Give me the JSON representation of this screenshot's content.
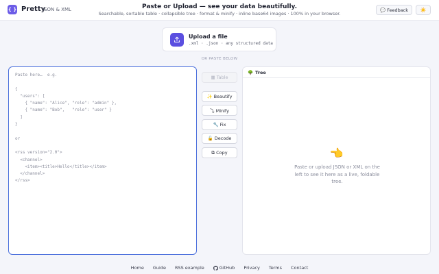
{
  "header": {
    "logo_glyph": "{ }",
    "brand": "Pretty",
    "brand_sub": "JSON & XML",
    "title": "Paste or Upload — see your data beautifully.",
    "subtitle": "Searchable, sortable table · collapsible tree · format & minify · inline base64 images · 100% in your browser.",
    "feedback_icon": "💬",
    "feedback_label": "Feedback",
    "theme_icon": "☀️"
  },
  "upload": {
    "title": "Upload a file",
    "subtitle": ".xml · .json · any structured data"
  },
  "divider": "OR PASTE BELOW",
  "editor": {
    "placeholder": "Paste here…  e.g.\n\n{\n  \"users\": [\n    { \"name\": \"Alice\", \"role\": \"admin\" },\n    { \"name\": \"Bob\",   \"role\": \"user\" }\n  ]\n}\n\nor\n\n<rss version=\"2.0\">\n  <channel>\n    <item><title>Hello</title></item>\n  </channel>\n</rss>"
  },
  "actions": {
    "table": "▦ Table",
    "beautify": "✨ Beautify",
    "minify": "⤵ Minify",
    "fix": "🔧 Fix",
    "decode": "🔓 Decode",
    "copy": "⧉ Copy"
  },
  "tree": {
    "icon": "🌳",
    "title": "Tree",
    "empty_icon": "👈",
    "empty_text": "Paste or upload JSON or XML on the left to see it here as a live, foldable tree."
  },
  "footer": {
    "links": [
      "Home",
      "Guide",
      "RSS example",
      "GitHub",
      "Privacy",
      "Terms",
      "Contact"
    ],
    "github_icon": "github-icon"
  },
  "colors": {
    "accent": "#5b4fe0",
    "editor_border": "#4a6fdc",
    "background": "#f4f5fa"
  }
}
